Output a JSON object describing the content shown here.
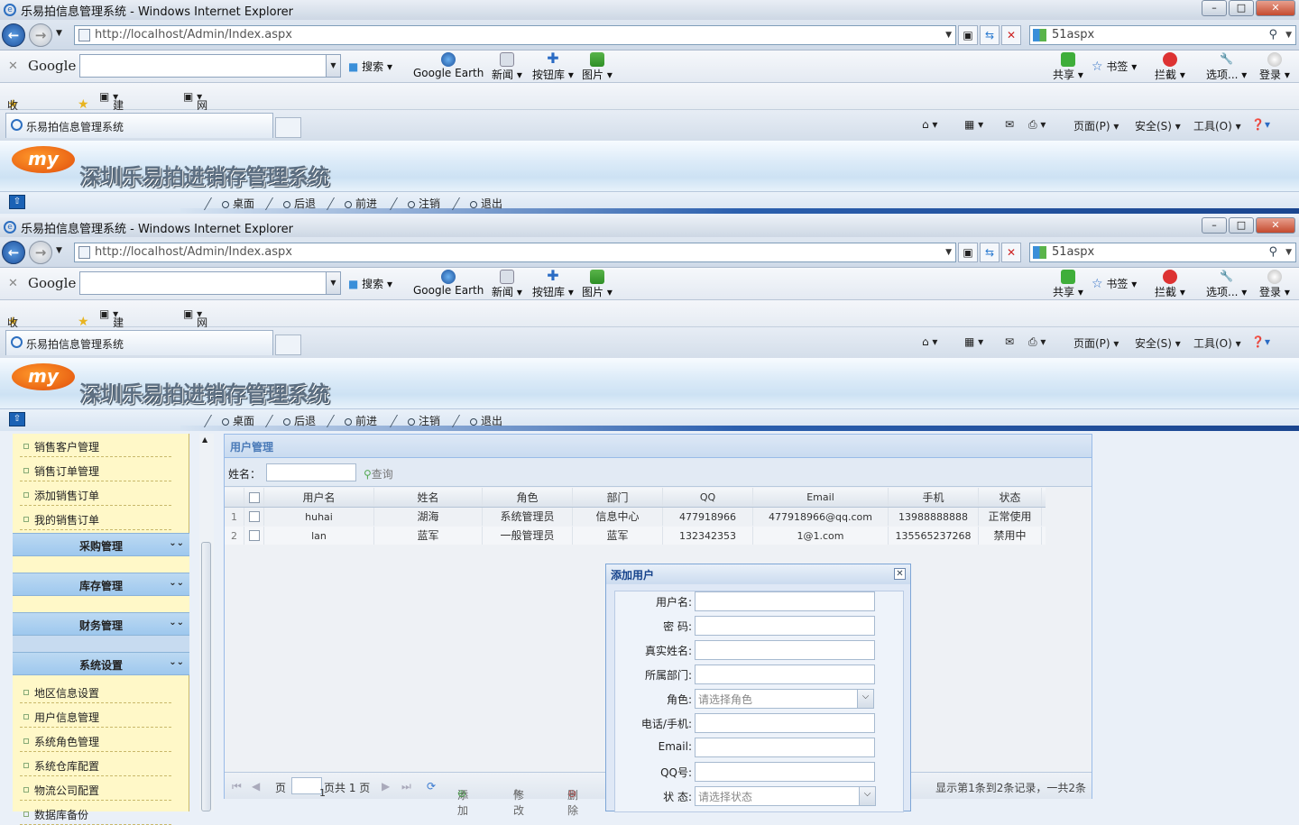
{
  "browser": {
    "window_title": "乐易拍信息管理系统 - Windows Internet Explorer",
    "url": "http://localhost/Admin/Index.aspx",
    "search_text": "51aspx",
    "google_bar": {
      "logo": "Google",
      "search_label": "搜索",
      "buttons": [
        "Google Earth",
        "新闻",
        "按钮库",
        "图片"
      ],
      "right_buttons": [
        "共享",
        "书签",
        "拦截",
        "选项...",
        "登录"
      ]
    },
    "favorites": {
      "label": "收藏夹",
      "items": [
        "建议网站",
        "网页快讯库"
      ]
    },
    "tab_title": "乐易拍信息管理系统",
    "command_bar": [
      "页面(P)",
      "安全(S)",
      "工具(O)"
    ]
  },
  "app": {
    "logo_text": "my",
    "title": "深圳乐易拍进销存管理系统",
    "nav_links": [
      "桌面",
      "后退",
      "前进",
      "注销",
      "退出"
    ]
  },
  "sidebar": {
    "items_top": [
      "销售客户管理",
      "销售订单管理",
      "添加销售订单",
      "我的销售订单"
    ],
    "sections": [
      "采购管理",
      "库存管理",
      "财务管理",
      "系统设置"
    ],
    "items_system": [
      "地区信息设置",
      "用户信息管理",
      "系统角色管理",
      "系统仓库配置",
      "物流公司配置",
      "数据库备份"
    ]
  },
  "panel": {
    "title": "用户管理",
    "search_label": "姓名：",
    "query_button": "查询"
  },
  "grid": {
    "columns": [
      "用户名",
      "姓名",
      "角色",
      "部门",
      "QQ",
      "Email",
      "手机",
      "状态"
    ],
    "rows": [
      {
        "index": "1",
        "username": "huhai",
        "name": "湖海",
        "role": "系统管理员",
        "dept": "信息中心",
        "qq": "477918966",
        "email": "477918966@qq.com",
        "phone": "13988888888",
        "status": "正常使用"
      },
      {
        "index": "2",
        "username": "lan",
        "name": "蓝军",
        "role": "一般管理员",
        "dept": "蓝军",
        "qq": "132342353",
        "email": "1@1.com",
        "phone": "135565237268",
        "status": "禁用中"
      }
    ]
  },
  "pager": {
    "page_label": "页",
    "page_value": "1",
    "total_pages": "页共 1 页",
    "add": "添加",
    "edit": "修改",
    "delete": "删除",
    "summary": "显示第1条到2条记录，一共2条"
  },
  "dialog": {
    "title": "添加用户",
    "fields": [
      {
        "label": "用户名:",
        "value": ""
      },
      {
        "label": "密  码:",
        "value": ""
      },
      {
        "label": "真实姓名:",
        "value": ""
      },
      {
        "label": "所属部门:",
        "value": ""
      },
      {
        "label": "角色:",
        "value": "请选择角色"
      },
      {
        "label": "电话/手机:",
        "value": ""
      },
      {
        "label": "Email:",
        "value": ""
      },
      {
        "label": "QQ号:",
        "value": ""
      },
      {
        "label": "状  态:",
        "value": "请选择状态"
      }
    ]
  }
}
